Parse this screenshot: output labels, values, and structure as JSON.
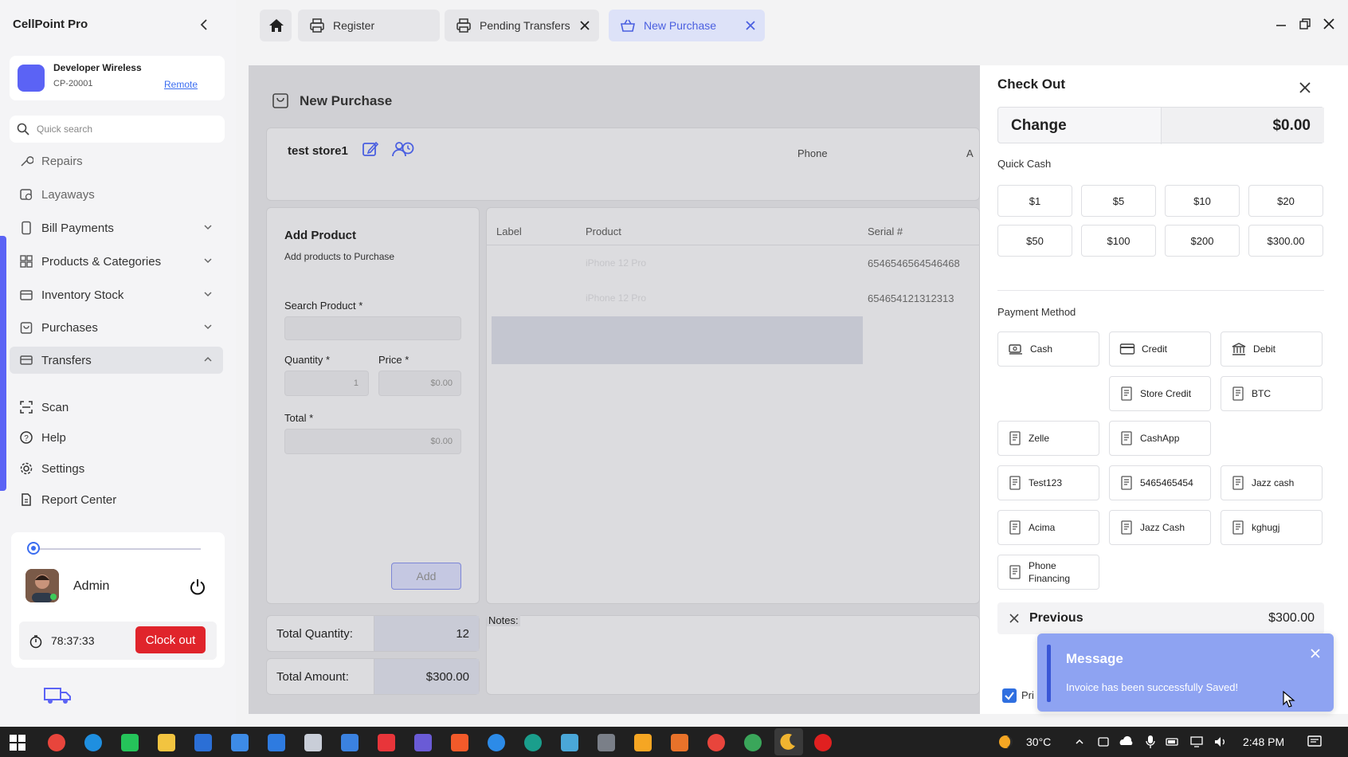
{
  "app": {
    "title": "CellPoint Pro"
  },
  "store": {
    "name": "Developer Wireless",
    "id": "CP-20001",
    "mode_link": "Remote"
  },
  "search": {
    "placeholder": "Quick search"
  },
  "nav": {
    "repairs": "Repairs",
    "layaways": "Layaways",
    "bill_payments": "Bill Payments",
    "products": "Products & Categories",
    "inventory": "Inventory Stock",
    "purchases": "Purchases",
    "transfers": "Transfers",
    "scan": "Scan",
    "help": "Help",
    "settings": "Settings",
    "report": "Report Center"
  },
  "user": {
    "name": "Admin",
    "timer": "78:37:33",
    "clock_out": "Clock out"
  },
  "tabs": {
    "register": "Register",
    "pending": "Pending Transfers",
    "new_purchase": "New Purchase"
  },
  "purchase": {
    "title": "New Purchase",
    "store_name": "test store1",
    "phone_label": "Phone",
    "clipped_label": "A",
    "add_product": {
      "title": "Add Product",
      "subtitle": "Add products to Purchase",
      "search_label": "Search Product *",
      "qty_label": "Quantity *",
      "qty_value": "1",
      "price_label": "Price *",
      "price_value": "$0.00",
      "total_label": "Total *",
      "total_value": "$0.00",
      "add_button": "Add"
    },
    "table": {
      "headers": {
        "label": "Label",
        "product": "Product",
        "serial": "Serial #"
      },
      "rows": [
        {
          "product": "iPhone 12 Pro",
          "serial": "6546546564546468"
        },
        {
          "product": "iPhone 12 Pro",
          "serial": "654654121312313"
        }
      ]
    },
    "totals": {
      "qty_label": "Total Quantity:",
      "qty_value": "12",
      "amount_label": "Total Amount:",
      "amount_value": "$300.00"
    },
    "notes_label": "Notes:"
  },
  "checkout": {
    "title": "Check Out",
    "change_label": "Change",
    "change_value": "$0.00",
    "quick_cash_label": "Quick Cash",
    "quick_cash": [
      "$1",
      "$5",
      "$10",
      "$20",
      "$50",
      "$100",
      "$200",
      "$300.00"
    ],
    "payment_method_label": "Payment Method",
    "methods": {
      "cash": "Cash",
      "credit": "Credit",
      "debit": "Debit",
      "store_credit": "Store Credit",
      "btc": "BTC",
      "zelle": "Zelle",
      "cashapp": "CashApp",
      "test123": "Test123",
      "m5465": "5465465454",
      "jazz_cash_lower": "Jazz cash",
      "acima": "Acima",
      "jazz_cash": "Jazz Cash",
      "kghugj": "kghugj",
      "phone_financing": "Phone Financing"
    },
    "previous_label": "Previous",
    "previous_value": "$300.00",
    "print_label": "Pri"
  },
  "message": {
    "title": "Message",
    "body": "Invoice has been successfully Saved!"
  },
  "taskbar": {
    "temperature": "30°C",
    "time": "2:48 PM"
  }
}
